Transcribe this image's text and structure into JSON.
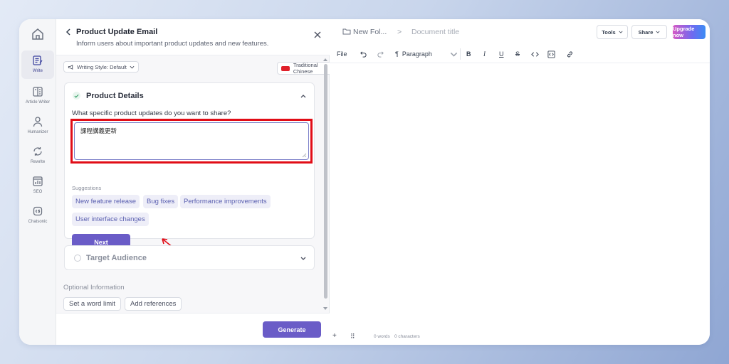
{
  "rail": {
    "items": [
      {
        "label": "Write",
        "icon": "edit-doc-icon"
      },
      {
        "label": "Article Writer",
        "icon": "article-icon"
      },
      {
        "label": "Humanizer",
        "icon": "person-icon"
      },
      {
        "label": "Rewrite",
        "icon": "rewrite-icon"
      },
      {
        "label": "SEO",
        "icon": "seo-chart-icon"
      },
      {
        "label": "Chatsonic",
        "icon": "chatsonic-icon"
      }
    ]
  },
  "panel": {
    "title": "Product Update Email",
    "subtitle": "Inform users about important product updates and new features.",
    "writing_style": "Writing Style: Default",
    "language": "Traditional Chinese",
    "section1": {
      "title": "Product Details",
      "question": "What specific product updates do you want to share?",
      "value": "課程講義更新",
      "suggestions_label": "Suggestions",
      "suggestions": [
        "New feature release",
        "Bug fixes",
        "Performance improvements",
        "User interface changes"
      ],
      "next_label": "Next"
    },
    "section2": {
      "title": "Target Audience"
    },
    "optional": {
      "label": "Optional Information",
      "buttons": [
        "Set a word limit",
        "Add references"
      ]
    },
    "generate_label": "Generate"
  },
  "editor": {
    "folder": "New Fol...",
    "separator": ">",
    "doc_title": "Document title",
    "tools_label": "Tools",
    "share_label": "Share",
    "upgrade_label": "Upgrade now",
    "toolbar": {
      "file": "File",
      "paragraph": "Paragraph"
    },
    "words": "0 words",
    "characters": "0 characters"
  },
  "colors": {
    "accent": "#6a5cc7",
    "highlight": "#e10d17"
  }
}
